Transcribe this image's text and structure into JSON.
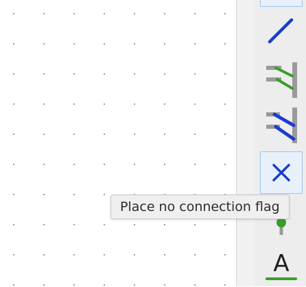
{
  "colors": {
    "wire_blue": "#1a3ccc",
    "bus_green": "#3a9d2a",
    "entry_gray": "#9a9a9a",
    "selection_border": "#9ec3e6",
    "tooltip_bg": "#efefef"
  },
  "toolbar": {
    "tools": [
      {
        "id": "top-partial",
        "icon": "tool-icon",
        "selected": false
      },
      {
        "id": "wire",
        "icon": "wire-icon",
        "selected": false
      },
      {
        "id": "bus-entry",
        "icon": "bus-entry-icon",
        "selected": false
      },
      {
        "id": "wire-entry",
        "icon": "wire-entry-icon",
        "selected": false
      },
      {
        "id": "no-connect",
        "icon": "no-connect-flag-icon",
        "selected": true
      },
      {
        "id": "junction",
        "icon": "junction-icon",
        "selected": false
      },
      {
        "id": "text",
        "icon": "text-icon",
        "selected": false,
        "glyph": "A"
      }
    ]
  },
  "tooltip": {
    "text": "Place no connection flag"
  }
}
